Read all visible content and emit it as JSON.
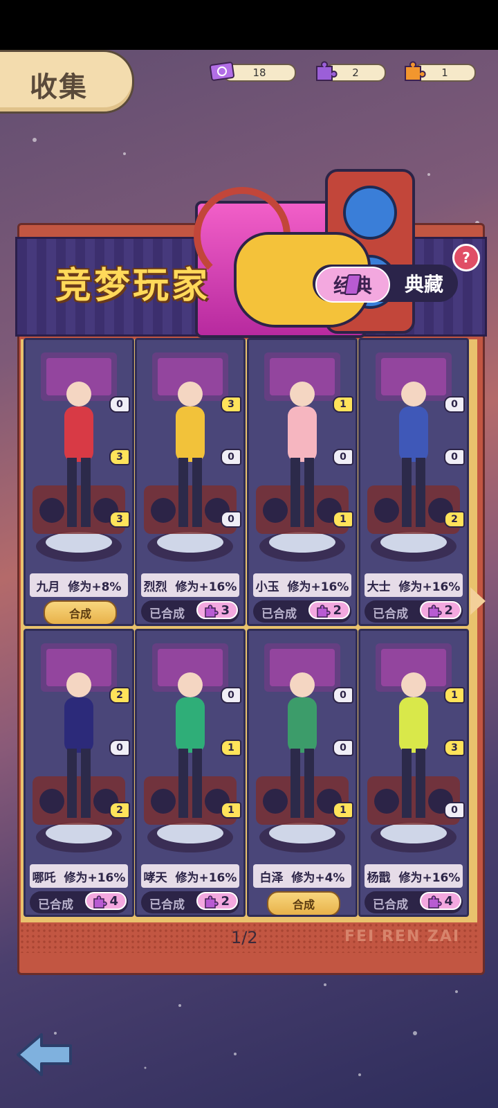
{
  "header": {
    "title": "收集"
  },
  "currencies": [
    {
      "icon": "ticket-icon",
      "value": "18",
      "color": "#b26ee6"
    },
    {
      "icon": "purple-puzzle-icon",
      "value": "2",
      "color": "#9b5fd8"
    },
    {
      "icon": "orange-puzzle-icon",
      "value": "1",
      "color": "#f2962e"
    }
  ],
  "banner": {
    "title": "竞梦玩家"
  },
  "tabs": {
    "classic": "经典",
    "collection": "典藏"
  },
  "help": {
    "label": "?"
  },
  "cards": [
    {
      "name": "九月",
      "bonus": "修为+8%",
      "status": "synth",
      "action": "合成",
      "badges": [
        "0",
        "3",
        "3"
      ],
      "figure_color": "#d83a45"
    },
    {
      "name": "烈烈",
      "bonus": "修为+16%",
      "status": "done",
      "done_label": "已合成",
      "count": "3",
      "badges": [
        "3",
        "0",
        "0"
      ],
      "figure_color": "#f2c23a"
    },
    {
      "name": "小玉",
      "bonus": "修为+16%",
      "status": "done",
      "done_label": "已合成",
      "count": "2",
      "badges": [
        "1",
        "0",
        "1"
      ],
      "figure_color": "#f6b6c0"
    },
    {
      "name": "大士",
      "bonus": "修为+16%",
      "status": "done",
      "done_label": "已合成",
      "count": "2",
      "badges": [
        "0",
        "0",
        "2"
      ],
      "figure_color": "#3f58b8"
    },
    {
      "name": "哪吒",
      "bonus": "修为+16%",
      "status": "done",
      "done_label": "已合成",
      "count": "4",
      "badges": [
        "2",
        "0",
        "2"
      ],
      "figure_color": "#2c2a7a"
    },
    {
      "name": "哮天",
      "bonus": "修为+16%",
      "status": "done",
      "done_label": "已合成",
      "count": "2",
      "badges": [
        "0",
        "1",
        "1"
      ],
      "figure_color": "#2fae78"
    },
    {
      "name": "白泽",
      "bonus": "修为+4%",
      "status": "synth",
      "action": "合成",
      "badges": [
        "0",
        "0",
        "1"
      ],
      "figure_color": "#3c9c6a"
    },
    {
      "name": "杨戬",
      "bonus": "修为+16%",
      "status": "done",
      "done_label": "已合成",
      "count": "4",
      "badges": [
        "1",
        "3",
        "0"
      ],
      "figure_color": "#d9e84a"
    }
  ],
  "pagination": {
    "label": "1/2"
  },
  "watermark": "FEI REN ZAI"
}
